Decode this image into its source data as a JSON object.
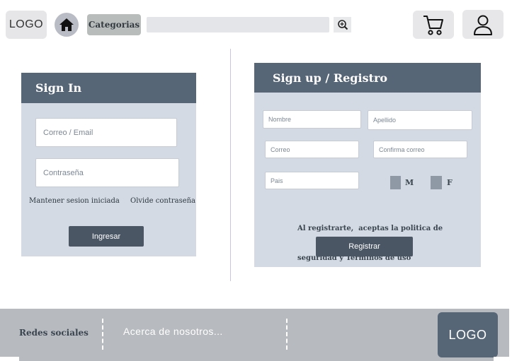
{
  "header": {
    "logo": "LOGO",
    "home_icon": "home-icon",
    "categories": "Categorias",
    "search_placeholder": "",
    "search_icon": "zoom-in-icon",
    "cart_icon": "cart-icon",
    "user_icon": "user-icon"
  },
  "signin": {
    "title": "Sign In",
    "email_placeholder": "Correo / Email",
    "password_placeholder": "Contraseña",
    "keep_session": "Mantener sesion iniciada",
    "forgot_password": "Olvide contraseña",
    "submit": "Ingresar"
  },
  "signup": {
    "title": "Sign up / Registro",
    "first_name": "Nombre",
    "last_name": "Apellido",
    "email": "Correo",
    "confirm_email": "Confirma correo",
    "country": "Pais",
    "gender_m": "M",
    "gender_f": "F",
    "terms_line1": "Al registrarte,  aceptas la politica de",
    "terms_line2": "seguridad y Terminos de uso",
    "submit": "Registrar"
  },
  "footer": {
    "social": "Redes sociales",
    "about": "Acerca de nosotros...",
    "logo": "LOGO"
  },
  "colors": {
    "panel_header": "#566677",
    "panel_body": "#d3dae3",
    "footer": "#b7babe"
  }
}
